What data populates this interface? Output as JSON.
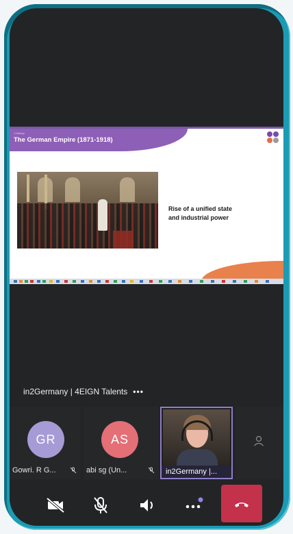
{
  "slide": {
    "tag": "1 History",
    "title": "The German Empire (1871-1918)",
    "body_line1": "Rise of a unified state",
    "body_line2": "and industrial power",
    "logo_colors": [
      "#7b4aa8",
      "#e46f4d",
      "#9b9b9b",
      "#4a7fc1"
    ]
  },
  "meeting": {
    "title": "in2Germany | 4EIGN Talents",
    "more_label": "•••"
  },
  "participants": [
    {
      "initials": "GR",
      "name": "Gowri. R G...",
      "color": "#a79bd6"
    },
    {
      "initials": "AS",
      "name": "abi sg (Un...",
      "color": "#e46f76"
    },
    {
      "initials": "",
      "name": "in2Germany |..."
    }
  ],
  "controls": [
    {
      "icon": "video-off-icon"
    },
    {
      "icon": "mic-off-icon"
    },
    {
      "icon": "speaker-icon"
    },
    {
      "icon": "more-options-icon"
    },
    {
      "icon": "hang-up-icon"
    }
  ],
  "colors": {
    "frame": "#1b9bb4",
    "background": "#232426",
    "hangup": "#c4314b",
    "accent": "#8f7fc7"
  }
}
